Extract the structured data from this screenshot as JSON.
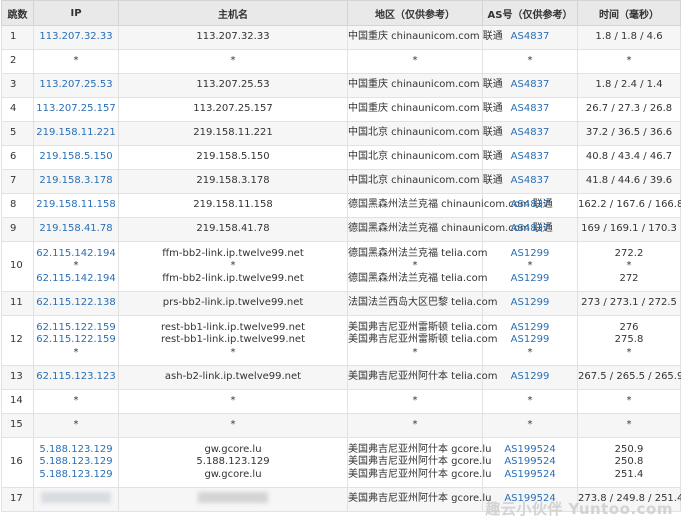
{
  "headers": [
    "跳数",
    "IP",
    "主机名",
    "地区（仅供参考）",
    "AS号（仅供参考）",
    "时间（毫秒）"
  ],
  "rows": [
    {
      "hop": "1",
      "ips": [
        "113.207.32.33"
      ],
      "hosts": [
        "113.207.32.33"
      ],
      "regions": [
        "中国重庆 chinaunicom.com 联通"
      ],
      "asns": [
        "AS4837"
      ],
      "times": [
        "1.8 / 1.8 / 4.6"
      ]
    },
    {
      "hop": "2",
      "ips": [
        "*"
      ],
      "hosts": [
        "*"
      ],
      "regions": [
        "*"
      ],
      "asns": [
        "*"
      ],
      "times": [
        "*"
      ]
    },
    {
      "hop": "3",
      "ips": [
        "113.207.25.53"
      ],
      "hosts": [
        "113.207.25.53"
      ],
      "regions": [
        "中国重庆 chinaunicom.com 联通"
      ],
      "asns": [
        "AS4837"
      ],
      "times": [
        "1.8 / 2.4 / 1.4"
      ]
    },
    {
      "hop": "4",
      "ips": [
        "113.207.25.157"
      ],
      "hosts": [
        "113.207.25.157"
      ],
      "regions": [
        "中国重庆 chinaunicom.com 联通"
      ],
      "asns": [
        "AS4837"
      ],
      "times": [
        "26.7 / 27.3 / 26.8"
      ]
    },
    {
      "hop": "5",
      "ips": [
        "219.158.11.221"
      ],
      "hosts": [
        "219.158.11.221"
      ],
      "regions": [
        "中国北京 chinaunicom.com 联通"
      ],
      "asns": [
        "AS4837"
      ],
      "times": [
        "37.2 / 36.5 / 36.6"
      ]
    },
    {
      "hop": "6",
      "ips": [
        "219.158.5.150"
      ],
      "hosts": [
        "219.158.5.150"
      ],
      "regions": [
        "中国北京 chinaunicom.com 联通"
      ],
      "asns": [
        "AS4837"
      ],
      "times": [
        "40.8 / 43.4 / 46.7"
      ]
    },
    {
      "hop": "7",
      "ips": [
        "219.158.3.178"
      ],
      "hosts": [
        "219.158.3.178"
      ],
      "regions": [
        "中国北京 chinaunicom.com 联通"
      ],
      "asns": [
        "AS4837"
      ],
      "times": [
        "41.8 / 44.6 / 39.6"
      ]
    },
    {
      "hop": "8",
      "ips": [
        "219.158.11.158"
      ],
      "hosts": [
        "219.158.11.158"
      ],
      "regions": [
        "德国黑森州法兰克福 chinaunicom.com 联通"
      ],
      "asns": [
        "AS4837"
      ],
      "times": [
        "162.2 / 167.6 / 166.8"
      ]
    },
    {
      "hop": "9",
      "ips": [
        "219.158.41.78"
      ],
      "hosts": [
        "219.158.41.78"
      ],
      "regions": [
        "德国黑森州法兰克福 chinaunicom.com 联通"
      ],
      "asns": [
        "AS4837"
      ],
      "times": [
        "169 / 169.1 / 170.3"
      ]
    },
    {
      "hop": "10",
      "ips": [
        "62.115.142.194",
        "*",
        "62.115.142.194"
      ],
      "hosts": [
        "ffm-bb2-link.ip.twelve99.net",
        "*",
        "ffm-bb2-link.ip.twelve99.net"
      ],
      "regions": [
        "德国黑森州法兰克福 telia.com",
        "*",
        "德国黑森州法兰克福 telia.com"
      ],
      "asns": [
        "AS1299",
        "*",
        "AS1299"
      ],
      "times": [
        "272.2",
        "*",
        "272"
      ]
    },
    {
      "hop": "11",
      "ips": [
        "62.115.122.138"
      ],
      "hosts": [
        "prs-bb2-link.ip.twelve99.net"
      ],
      "regions": [
        "法国法兰西岛大区巴黎 telia.com"
      ],
      "asns": [
        "AS1299"
      ],
      "times": [
        "273 / 273.1 / 272.5"
      ]
    },
    {
      "hop": "12",
      "ips": [
        "62.115.122.159",
        "62.115.122.159",
        "*"
      ],
      "hosts": [
        "rest-bb1-link.ip.twelve99.net",
        "rest-bb1-link.ip.twelve99.net",
        "*"
      ],
      "regions": [
        "美国弗吉尼亚州雷斯顿 telia.com",
        "美国弗吉尼亚州雷斯顿 telia.com",
        "*"
      ],
      "asns": [
        "AS1299",
        "AS1299",
        "*"
      ],
      "times": [
        "276",
        "275.8",
        "*"
      ]
    },
    {
      "hop": "13",
      "ips": [
        "62.115.123.123"
      ],
      "hosts": [
        "ash-b2-link.ip.twelve99.net"
      ],
      "regions": [
        "美国弗吉尼亚州阿什本 telia.com"
      ],
      "asns": [
        "AS1299"
      ],
      "times": [
        "267.5 / 265.5 / 265.9"
      ]
    },
    {
      "hop": "14",
      "ips": [
        "*"
      ],
      "hosts": [
        "*"
      ],
      "regions": [
        "*"
      ],
      "asns": [
        "*"
      ],
      "times": [
        "*"
      ]
    },
    {
      "hop": "15",
      "ips": [
        "*"
      ],
      "hosts": [
        "*"
      ],
      "regions": [
        "*"
      ],
      "asns": [
        "*"
      ],
      "times": [
        "*"
      ]
    },
    {
      "hop": "16",
      "ips": [
        "5.188.123.129",
        "5.188.123.129",
        "5.188.123.129"
      ],
      "hosts": [
        "gw.gcore.lu",
        "5.188.123.129",
        "gw.gcore.lu"
      ],
      "regions": [
        "美国弗吉尼亚州阿什本 gcore.lu",
        "美国弗吉尼亚州阿什本 gcore.lu",
        "美国弗吉尼亚州阿什本 gcore.lu"
      ],
      "asns": [
        "AS199524",
        "AS199524",
        "AS199524"
      ],
      "times": [
        "250.9",
        "250.8",
        "251.4"
      ]
    },
    {
      "hop": "17",
      "ips": [],
      "hosts": [],
      "regions": [
        "美国弗吉尼亚州阿什本 gcore.lu"
      ],
      "asns": [
        "AS199524"
      ],
      "times": [
        "273.8 / 249.8 / 251.4"
      ]
    }
  ],
  "watermark": "趣云小伙伴 Yuntoo.com"
}
